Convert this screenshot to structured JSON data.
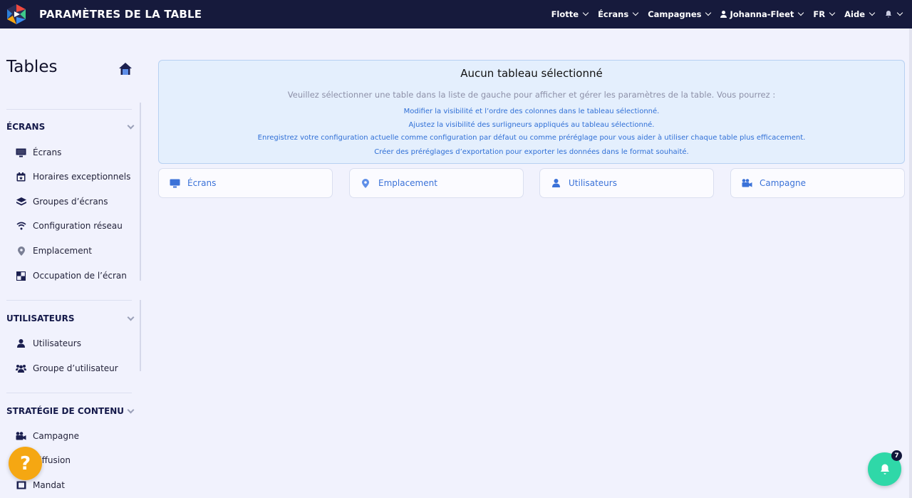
{
  "app": {
    "title": "PARAMÈTRES DE LA TABLE"
  },
  "nav": {
    "items": [
      {
        "label": "Flotte"
      },
      {
        "label": "Écrans"
      },
      {
        "label": "Campagnes"
      },
      {
        "label": "Johanna-Fleet",
        "icon": "user-icon"
      },
      {
        "label": "FR"
      },
      {
        "label": "Aide"
      },
      {
        "label": "",
        "icon": "bell-icon"
      }
    ]
  },
  "sidebar": {
    "title": "Tables",
    "sections": [
      {
        "title": "ÉCRANS",
        "items": [
          {
            "label": "Écrans",
            "icon": "monitor-icon"
          },
          {
            "label": "Horaires exceptionnels",
            "icon": "calendar-icon"
          },
          {
            "label": "Groupes d’écrans",
            "icon": "layers-icon"
          },
          {
            "label": "Configuration réseau",
            "icon": "wifi-icon"
          },
          {
            "label": "Emplacement",
            "icon": "location-pin-icon"
          },
          {
            "label": "Occupation de l’écran",
            "icon": "screen-layout-icon"
          }
        ]
      },
      {
        "title": "UTILISATEURS",
        "items": [
          {
            "label": "Utilisateurs",
            "icon": "user-icon"
          },
          {
            "label": "Groupe d’utilisateur",
            "icon": "users-group-icon"
          }
        ]
      },
      {
        "title": "STRATÉGIE DE CONTENU",
        "items": [
          {
            "label": "Campagne",
            "icon": "video-camera-icon"
          },
          {
            "label": "Diffusion",
            "icon": "broadcast-icon"
          },
          {
            "label": "Mandat",
            "icon": "film-icon"
          }
        ]
      }
    ]
  },
  "info": {
    "title": "Aucun tableau sélectionné",
    "subtitle": "Veuillez sélectionner une table dans la liste de gauche pour afficher et gérer les paramètres de la table. Vous pourrez :",
    "lines": [
      "Modifier la visibilité et l’ordre des colonnes dans le tableau sélectionné.",
      "Ajustez la visibilité des surligneurs appliqués au tableau sélectionné.",
      "Enregistrez votre configuration actuelle comme configuration par défaut ou comme préréglage pour vous aider à utiliser chaque table plus efficacement.",
      "Créer des préréglages d’exportation pour exporter les données dans le format souhaité."
    ]
  },
  "table_cards": [
    {
      "label": "Écrans",
      "icon": "monitor-icon"
    },
    {
      "label": "Emplacement",
      "icon": "location-pin-icon"
    },
    {
      "label": "Utilisateurs",
      "icon": "user-icon"
    },
    {
      "label": "Campagne",
      "icon": "video-camera-icon"
    }
  ],
  "help": {
    "label": "?"
  },
  "notifications": {
    "count": "7"
  },
  "colors": {
    "navbar": "#161a3c",
    "accent_blue": "#3b72d8",
    "help_orange": "#f5a712",
    "notif_green": "#2fd8a8"
  }
}
